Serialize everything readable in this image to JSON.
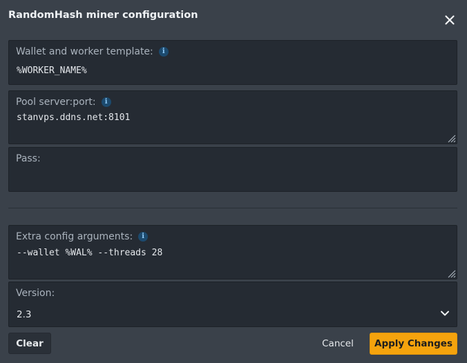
{
  "dialog": {
    "title": "RandomHash miner configuration",
    "close_icon": "close-icon"
  },
  "fields": {
    "wallet": {
      "label": "Wallet and worker template:",
      "value": "%WORKER_NAME%",
      "info_icon": "info-icon"
    },
    "pool": {
      "label": "Pool server:port:",
      "value": "stanvps.ddns.net:8101",
      "info_icon": "info-icon"
    },
    "pass": {
      "label": "Pass:",
      "value": ""
    },
    "extra": {
      "label": "Extra config arguments:",
      "value": "--wallet %WAL% --threads 28",
      "info_icon": "info-icon"
    },
    "version": {
      "label": "Version:",
      "value": "2.3",
      "dropdown_icon": "chevron-down-icon"
    }
  },
  "footer": {
    "clear_label": "Clear",
    "cancel_label": "Cancel",
    "apply_label": "Apply Changes"
  },
  "colors": {
    "background": "#3a414a",
    "field_background": "#252b33",
    "accent": "#f5a30d",
    "info": "#8ec8f5"
  }
}
